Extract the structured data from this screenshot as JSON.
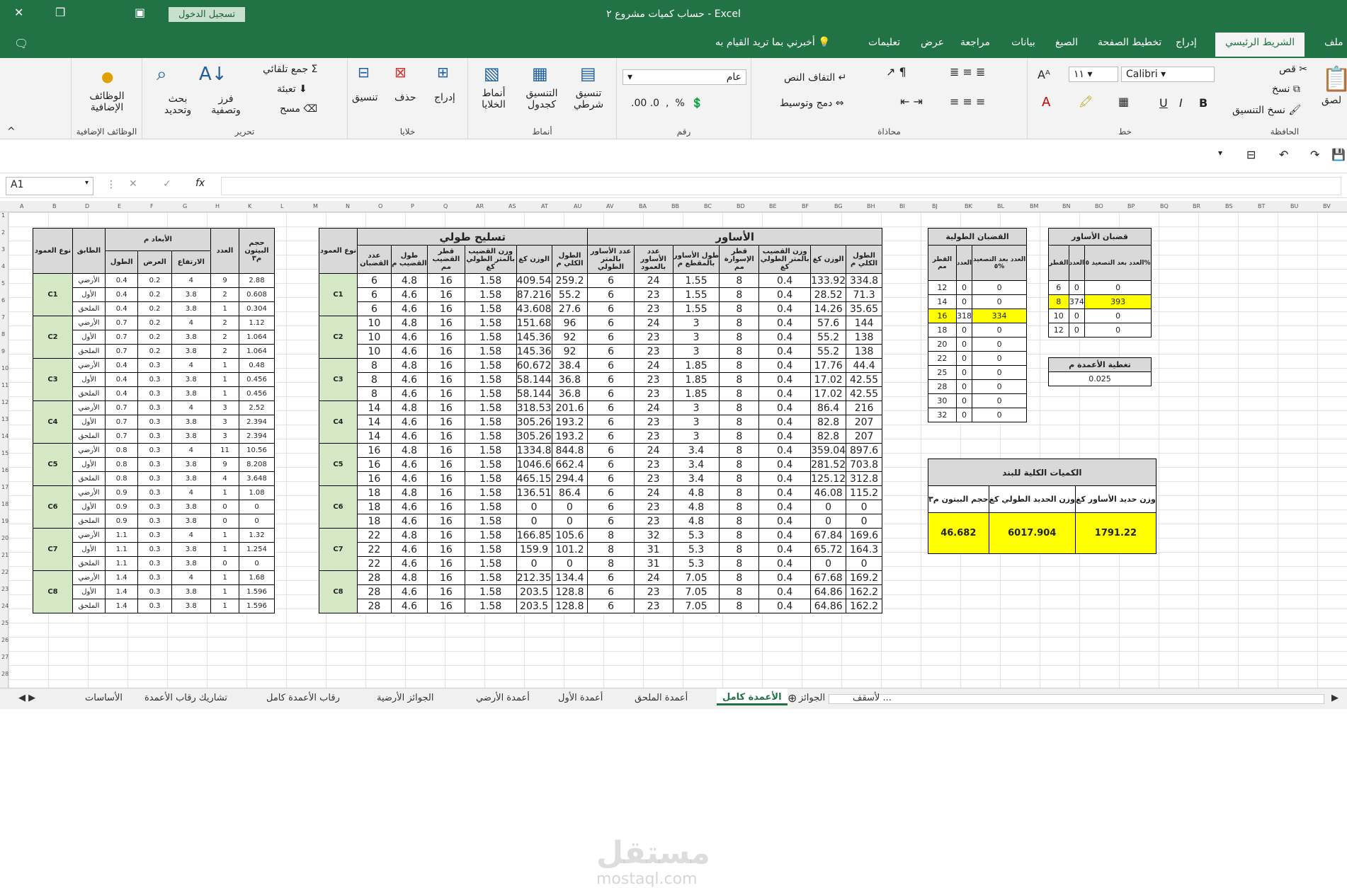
{
  "window": {
    "title": "حساب كميات مشروع ٢ - Excel",
    "signin": "تسجيل الدخول"
  },
  "tabs": [
    "ملف",
    "الشريط الرئيسي",
    "إدراج",
    "تخطيط الصفحة",
    "الصيغ",
    "بيانات",
    "مراجعة",
    "عرض",
    "تعليمات"
  ],
  "tell_me": "أخبرني بما تريد القيام به",
  "ribbon": {
    "clipboard": {
      "label": "الحافظة",
      "paste": "لصق",
      "cut": "قص",
      "copy": "نسخ",
      "format_painter": "نسخ التنسيق"
    },
    "font": {
      "label": "خط",
      "name": "Calibri",
      "size": "١١",
      "bold": "B",
      "italic": "I",
      "underline": "U"
    },
    "alignment": {
      "label": "محاذاة",
      "wrap": "التفاف النص",
      "merge": "دمج وتوسيط"
    },
    "number": {
      "label": "رقم",
      "format": "عام"
    },
    "styles": {
      "label": "أنماط",
      "conditional": "تنسيق شرطي",
      "as_table": "التنسيق كجدول",
      "cell_styles": "أنماط الخلايا"
    },
    "cells": {
      "label": "خلايا",
      "insert": "إدراج",
      "delete": "حذف",
      "format": "تنسيق"
    },
    "editing": {
      "label": "تحرير",
      "autosum": "جمع تلقائي",
      "fill": "تعبئة",
      "clear": "مسح",
      "sort": "فرز وتصفية",
      "find": "بحث وتحديد"
    },
    "addins": {
      "label": "الوظائف الإضافية",
      "btn": "الوظائف الإضافية"
    }
  },
  "namebox": "A1",
  "fx": "fx",
  "columns": [
    "A",
    "B",
    "D",
    "E",
    "F",
    "G",
    "H",
    "K",
    "L",
    "M",
    "N",
    "O",
    "P",
    "Q",
    "AR",
    "AS",
    "AT",
    "AU",
    "AV",
    "BA",
    "BB",
    "BC",
    "BD",
    "BE",
    "BF",
    "BG",
    "BH",
    "BI",
    "BJ",
    "BK",
    "BL",
    "BM",
    "BN",
    "BO",
    "BP",
    "BQ",
    "BR",
    "BS",
    "BT",
    "BU",
    "BV"
  ],
  "table_dims": {
    "header_col_type": "نوع العمود",
    "header_floor": "الطابق",
    "header_dims": "الأبعاد م",
    "header_len": "الطول",
    "header_wid": "العرض",
    "header_hgt": "الارتفاع",
    "header_count": "العدد",
    "header_vol": "حجم البيتون م٣",
    "groups": [
      {
        "col": "C1",
        "rows": [
          [
            "الأرضي",
            "0.4",
            "0.2",
            "4",
            "9",
            "2.88"
          ],
          [
            "الأول",
            "0.4",
            "0.2",
            "3.8",
            "2",
            "0.608"
          ],
          [
            "الملحق",
            "0.4",
            "0.2",
            "3.8",
            "1",
            "0.304"
          ]
        ]
      },
      {
        "col": "C2",
        "rows": [
          [
            "الأرضي",
            "0.7",
            "0.2",
            "4",
            "2",
            "1.12"
          ],
          [
            "الأول",
            "0.7",
            "0.2",
            "3.8",
            "2",
            "1.064"
          ],
          [
            "الملحق",
            "0.7",
            "0.2",
            "3.8",
            "2",
            "1.064"
          ]
        ]
      },
      {
        "col": "C3",
        "rows": [
          [
            "الأرضي",
            "0.4",
            "0.3",
            "4",
            "1",
            "0.48"
          ],
          [
            "الأول",
            "0.4",
            "0.3",
            "3.8",
            "1",
            "0.456"
          ],
          [
            "الملحق",
            "0.4",
            "0.3",
            "3.8",
            "1",
            "0.456"
          ]
        ]
      },
      {
        "col": "C4",
        "rows": [
          [
            "الأرضي",
            "0.7",
            "0.3",
            "4",
            "3",
            "2.52"
          ],
          [
            "الأول",
            "0.7",
            "0.3",
            "3.8",
            "3",
            "2.394"
          ],
          [
            "الملحق",
            "0.7",
            "0.3",
            "3.8",
            "3",
            "2.394"
          ]
        ]
      },
      {
        "col": "C5",
        "rows": [
          [
            "الأرضي",
            "0.8",
            "0.3",
            "4",
            "11",
            "10.56"
          ],
          [
            "الأول",
            "0.8",
            "0.3",
            "3.8",
            "9",
            "8.208"
          ],
          [
            "الملحق",
            "0.8",
            "0.3",
            "3.8",
            "4",
            "3.648"
          ]
        ]
      },
      {
        "col": "C6",
        "rows": [
          [
            "الأرضي",
            "0.9",
            "0.3",
            "4",
            "1",
            "1.08"
          ],
          [
            "الأول",
            "0.9",
            "0.3",
            "3.8",
            "0",
            "0"
          ],
          [
            "الملحق",
            "0.9",
            "0.3",
            "3.8",
            "0",
            "0"
          ]
        ]
      },
      {
        "col": "C7",
        "rows": [
          [
            "الأرضي",
            "1.1",
            "0.3",
            "4",
            "1",
            "1.32"
          ],
          [
            "الأول",
            "1.1",
            "0.3",
            "3.8",
            "1",
            "1.254"
          ],
          [
            "الملحق",
            "1.1",
            "0.3",
            "3.8",
            "0",
            "0"
          ]
        ]
      },
      {
        "col": "C8",
        "rows": [
          [
            "الأرضي",
            "1.4",
            "0.3",
            "4",
            "1",
            "1.68"
          ],
          [
            "الأول",
            "1.4",
            "0.3",
            "3.8",
            "1",
            "1.596"
          ],
          [
            "الملحق",
            "1.4",
            "0.3",
            "3.8",
            "1",
            "1.596"
          ]
        ]
      }
    ]
  },
  "table_rebar": {
    "title_long": "تسليح طولي",
    "title_stir": "الأساور",
    "header_col_type": "نوع العمود",
    "long_headers": [
      "عدد القضبان",
      "طول القضيب م",
      "قطر القضيب مم",
      "وزن القضيب بالمتر الطولي كغ",
      "الوزن كغ",
      "الطول الكلي م"
    ],
    "stir_headers": [
      "عدد الأساور بالمتر الطولي",
      "عدد الأساور بالعمود",
      "طول الأساور بالمقطع م",
      "قطر الإسوارة مم",
      "وزن القضيب بالمتر الطولي كغ",
      "الوزن كغ",
      "الطول الكلي م"
    ],
    "groups": [
      {
        "col": "C1",
        "rows": [
          [
            "6",
            "4.8",
            "16",
            "1.58",
            "409.54",
            "259.2",
            "6",
            "24",
            "1.55",
            "8",
            "0.4",
            "133.92",
            "334.8"
          ],
          [
            "6",
            "4.6",
            "16",
            "1.58",
            "87.216",
            "55.2",
            "6",
            "23",
            "1.55",
            "8",
            "0.4",
            "28.52",
            "71.3"
          ],
          [
            "6",
            "4.6",
            "16",
            "1.58",
            "43.608",
            "27.6",
            "6",
            "23",
            "1.55",
            "8",
            "0.4",
            "14.26",
            "35.65"
          ]
        ]
      },
      {
        "col": "C2",
        "rows": [
          [
            "10",
            "4.8",
            "16",
            "1.58",
            "151.68",
            "96",
            "6",
            "24",
            "3",
            "8",
            "0.4",
            "57.6",
            "144"
          ],
          [
            "10",
            "4.6",
            "16",
            "1.58",
            "145.36",
            "92",
            "6",
            "23",
            "3",
            "8",
            "0.4",
            "55.2",
            "138"
          ],
          [
            "10",
            "4.6",
            "16",
            "1.58",
            "145.36",
            "92",
            "6",
            "23",
            "3",
            "8",
            "0.4",
            "55.2",
            "138"
          ]
        ]
      },
      {
        "col": "C3",
        "rows": [
          [
            "8",
            "4.8",
            "16",
            "1.58",
            "60.672",
            "38.4",
            "6",
            "24",
            "1.85",
            "8",
            "0.4",
            "17.76",
            "44.4"
          ],
          [
            "8",
            "4.6",
            "16",
            "1.58",
            "58.144",
            "36.8",
            "6",
            "23",
            "1.85",
            "8",
            "0.4",
            "17.02",
            "42.55"
          ],
          [
            "8",
            "4.6",
            "16",
            "1.58",
            "58.144",
            "36.8",
            "6",
            "23",
            "1.85",
            "8",
            "0.4",
            "17.02",
            "42.55"
          ]
        ]
      },
      {
        "col": "C4",
        "rows": [
          [
            "14",
            "4.8",
            "16",
            "1.58",
            "318.53",
            "201.6",
            "6",
            "24",
            "3",
            "8",
            "0.4",
            "86.4",
            "216"
          ],
          [
            "14",
            "4.6",
            "16",
            "1.58",
            "305.26",
            "193.2",
            "6",
            "23",
            "3",
            "8",
            "0.4",
            "82.8",
            "207"
          ],
          [
            "14",
            "4.6",
            "16",
            "1.58",
            "305.26",
            "193.2",
            "6",
            "23",
            "3",
            "8",
            "0.4",
            "82.8",
            "207"
          ]
        ]
      },
      {
        "col": "C5",
        "rows": [
          [
            "16",
            "4.8",
            "16",
            "1.58",
            "1334.8",
            "844.8",
            "6",
            "24",
            "3.4",
            "8",
            "0.4",
            "359.04",
            "897.6"
          ],
          [
            "16",
            "4.6",
            "16",
            "1.58",
            "1046.6",
            "662.4",
            "6",
            "23",
            "3.4",
            "8",
            "0.4",
            "281.52",
            "703.8"
          ],
          [
            "16",
            "4.6",
            "16",
            "1.58",
            "465.15",
            "294.4",
            "6",
            "23",
            "3.4",
            "8",
            "0.4",
            "125.12",
            "312.8"
          ]
        ]
      },
      {
        "col": "C6",
        "rows": [
          [
            "18",
            "4.8",
            "16",
            "1.58",
            "136.51",
            "86.4",
            "6",
            "24",
            "4.8",
            "8",
            "0.4",
            "46.08",
            "115.2"
          ],
          [
            "18",
            "4.6",
            "16",
            "1.58",
            "0",
            "0",
            "6",
            "23",
            "4.8",
            "8",
            "0.4",
            "0",
            "0"
          ],
          [
            "18",
            "4.6",
            "16",
            "1.58",
            "0",
            "0",
            "6",
            "23",
            "4.8",
            "8",
            "0.4",
            "0",
            "0"
          ]
        ]
      },
      {
        "col": "C7",
        "rows": [
          [
            "22",
            "4.8",
            "16",
            "1.58",
            "166.85",
            "105.6",
            "8",
            "32",
            "5.3",
            "8",
            "0.4",
            "67.84",
            "169.6"
          ],
          [
            "22",
            "4.6",
            "16",
            "1.58",
            "159.9",
            "101.2",
            "8",
            "31",
            "5.3",
            "8",
            "0.4",
            "65.72",
            "164.3"
          ],
          [
            "22",
            "4.6",
            "16",
            "1.58",
            "0",
            "0",
            "8",
            "31",
            "5.3",
            "8",
            "0.4",
            "0",
            "0"
          ]
        ]
      },
      {
        "col": "C8",
        "rows": [
          [
            "28",
            "4.8",
            "16",
            "1.58",
            "212.35",
            "134.4",
            "6",
            "24",
            "7.05",
            "8",
            "0.4",
            "67.68",
            "169.2"
          ],
          [
            "28",
            "4.6",
            "16",
            "1.58",
            "203.5",
            "128.8",
            "6",
            "23",
            "7.05",
            "8",
            "0.4",
            "64.86",
            "162.2"
          ],
          [
            "28",
            "4.6",
            "16",
            "1.58",
            "203.5",
            "128.8",
            "6",
            "23",
            "7.05",
            "8",
            "0.4",
            "64.86",
            "162.2"
          ]
        ]
      }
    ]
  },
  "long_bars": {
    "title": "القضبان الطولية",
    "headers": [
      "القطر مم",
      "العدد",
      "العدد بعد التصعيد ٥%"
    ],
    "rows": [
      [
        "12",
        "0",
        "0"
      ],
      [
        "14",
        "0",
        "0"
      ],
      [
        "16",
        "318",
        "334"
      ],
      [
        "18",
        "0",
        "0"
      ],
      [
        "20",
        "0",
        "0"
      ],
      [
        "22",
        "0",
        "0"
      ],
      [
        "25",
        "0",
        "0"
      ],
      [
        "28",
        "0",
        "0"
      ],
      [
        "30",
        "0",
        "0"
      ],
      [
        "32",
        "0",
        "0"
      ]
    ]
  },
  "stir_bars": {
    "title": "قضبان الأساور",
    "headers": [
      "القطر",
      "العدد",
      "العدد بعد التصعيد ٥%"
    ],
    "rows": [
      [
        "6",
        "0",
        "0"
      ],
      [
        "8",
        "374",
        "393"
      ],
      [
        "10",
        "0",
        "0"
      ],
      [
        "12",
        "0",
        "0"
      ]
    ]
  },
  "cover": {
    "title": "تغطية الأعمدة م",
    "value": "0.025"
  },
  "totals": {
    "title": "الكميات الكلية للبند",
    "headers": [
      "حجم البيتون م٣",
      "وزن الحديد الطولي كغ",
      "وزن حديد الأساور كغ"
    ],
    "values": [
      "46.682",
      "6017.904",
      "1791.22"
    ]
  },
  "sheet_tabs": [
    "الأساسات",
    "تشاريك رقاب الأعمدة",
    "رقاب الأعمدة كامل",
    "الجوائز الأرضية",
    "أعمدة الأرضي",
    "أعمدة الأول",
    "أعمدة الملحق",
    "الأعمدة كامل",
    "الجوائز",
    "لأسقف ..."
  ],
  "active_sheet": "الأعمدة كامل",
  "watermark": {
    "ar": "مستقل",
    "en": "mostaql.com"
  }
}
